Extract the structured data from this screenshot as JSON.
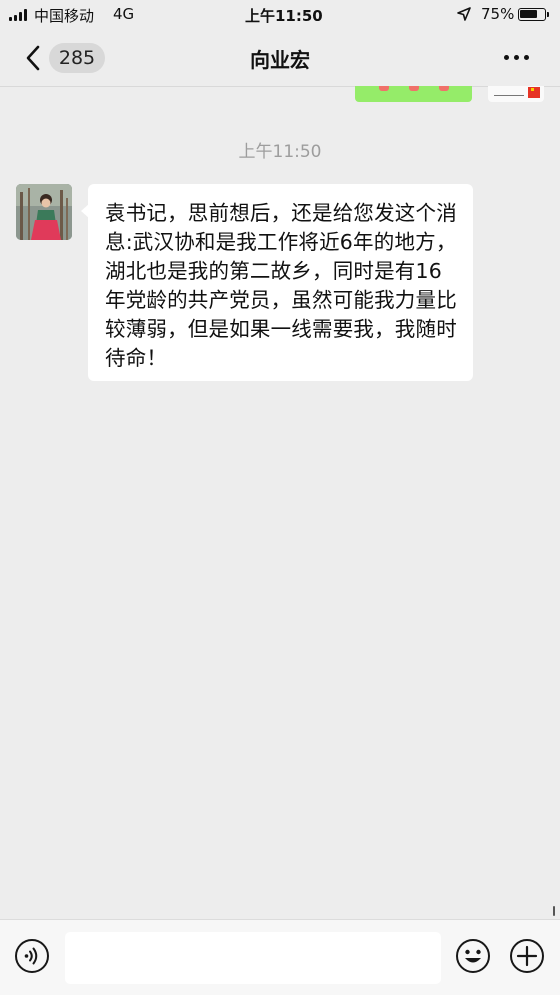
{
  "status_bar": {
    "carrier": "中国移动",
    "network": "4G",
    "time": "上午11:50",
    "battery_percent_label": "75%",
    "battery_level": 0.75,
    "icons": [
      "signal-icon",
      "location-arrow-icon",
      "battery-icon"
    ]
  },
  "nav": {
    "unread_count": "285",
    "title": "向业宏",
    "icons": [
      "back-chevron-icon",
      "more-dots-icon"
    ]
  },
  "chat": {
    "timestamp": "上午11:50",
    "messages": [
      {
        "direction": "incoming",
        "text": "袁书记，思前想后，还是给您发这个消息:武汉协和是我工作将近6年的地方，湖北也是我的第二故乡，同时是有16年党龄的共产党员，虽然可能我力量比较薄弱，但是如果一线需要我，我随时待命！"
      }
    ]
  },
  "input_bar": {
    "value": "",
    "icons": [
      "voice-icon",
      "emoji-icon",
      "plus-icon"
    ]
  },
  "colors": {
    "background": "#ededed",
    "sent_bubble": "#95ec69",
    "received_bubble": "#ffffff",
    "timestamp": "#9d9d9d"
  }
}
